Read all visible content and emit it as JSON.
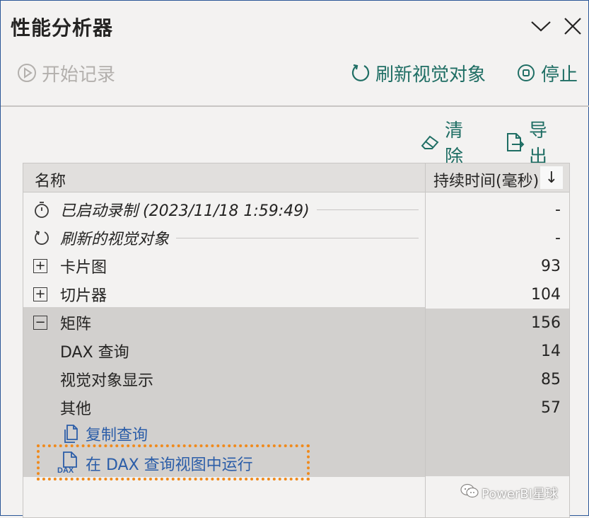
{
  "panel": {
    "title": "性能分析器"
  },
  "toolbar": {
    "start_label": "开始记录",
    "refresh_label": "刷新视觉对象",
    "stop_label": "停止"
  },
  "actions": {
    "clear_label": "清除",
    "export_label": "导出"
  },
  "table": {
    "header_name": "名称",
    "header_duration": "持续时间(毫秒)",
    "sort_glyph": "↓",
    "rows": [
      {
        "label": "已启动录制 (2023/11/18 1:59:49)",
        "value": "-"
      },
      {
        "label": "刷新的视觉对象",
        "value": "-"
      },
      {
        "label": "卡片图",
        "value": "93",
        "expander": "+"
      },
      {
        "label": "切片器",
        "value": "104",
        "expander": "+"
      },
      {
        "label": "矩阵",
        "value": "156",
        "expander": "−"
      },
      {
        "label": "DAX 查询",
        "value": "14"
      },
      {
        "label": "视觉对象显示",
        "value": "85"
      },
      {
        "label": "其他",
        "value": "57"
      }
    ],
    "links": {
      "copy_query": "复制查询",
      "run_in_dax": "在 DAX 查询视图中运行",
      "dax_icon_text": "DAX"
    }
  },
  "watermark": {
    "text": "PowerBI星球"
  },
  "colors": {
    "accent": "#1f6e64",
    "link": "#2b5da8",
    "highlight_box": "#f08a1c",
    "selected_row": "#d2d0ce"
  }
}
